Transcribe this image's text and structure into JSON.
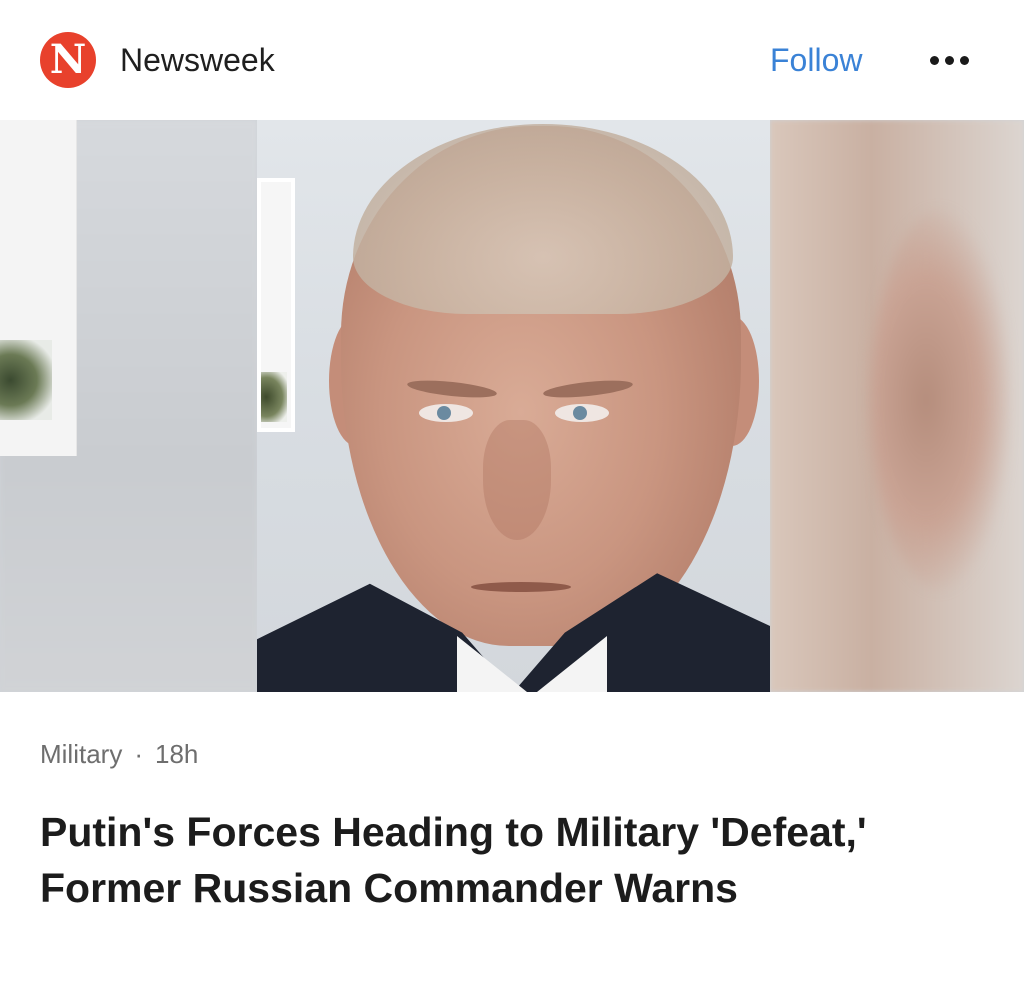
{
  "header": {
    "publisher_logo_letter": "N",
    "publisher_name": "Newsweek",
    "follow_label": "Follow",
    "more_icon": "more-horizontal-icon"
  },
  "article": {
    "category": "Military",
    "separator": "·",
    "age": "18h",
    "headline": "Putin's Forces Heading to Military 'Defeat,' Former Russian Commander Warns"
  },
  "colors": {
    "logo_red": "#e8412c",
    "follow_blue": "#3a82d6",
    "meta_gray": "#6e6e6e"
  }
}
